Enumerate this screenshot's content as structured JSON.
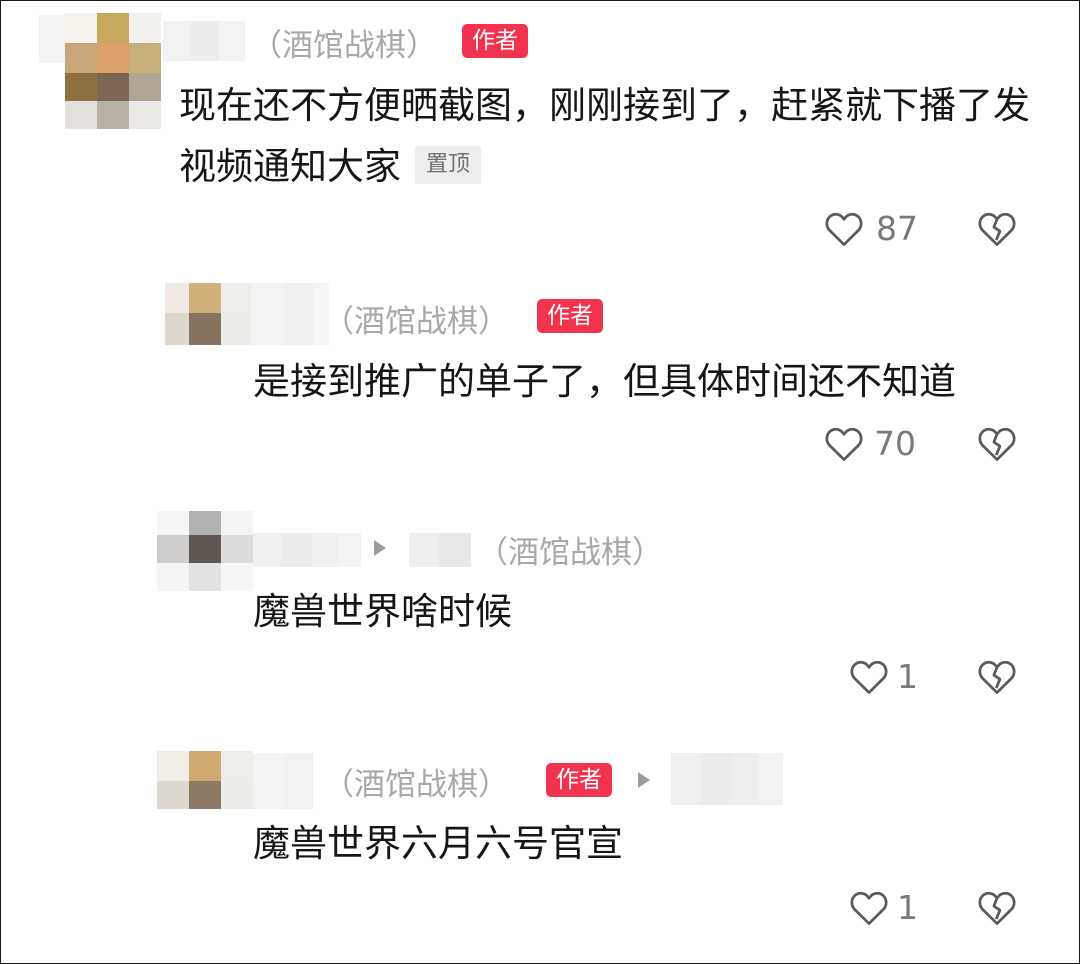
{
  "comments": [
    {
      "tag": "（酒馆战棋）",
      "badge": "作者",
      "text": "现在还不方便晒截图，刚刚接到了，赶紧就下播了发视频通知大家",
      "pin": "置顶",
      "likes": "87"
    },
    {
      "tag": "（酒馆战棋）",
      "badge": "作者",
      "text": "是接到推广的单子了，但具体时间还不知道",
      "likes": "70"
    },
    {
      "tag": "（酒馆战棋）",
      "text": "魔兽世界啥时候",
      "likes": "1"
    },
    {
      "tag": "（酒馆战棋）",
      "badge": "作者",
      "text": "魔兽世界六月六号官宣",
      "likes": "1"
    }
  ],
  "icons": {
    "like": "heart-outline-icon",
    "dislike": "broken-heart-icon",
    "reply_arrow": "triangle-right-icon"
  },
  "colors": {
    "badge": "#f2334f",
    "muted_text": "#a8a8a8",
    "count": "#7a7a7a"
  }
}
